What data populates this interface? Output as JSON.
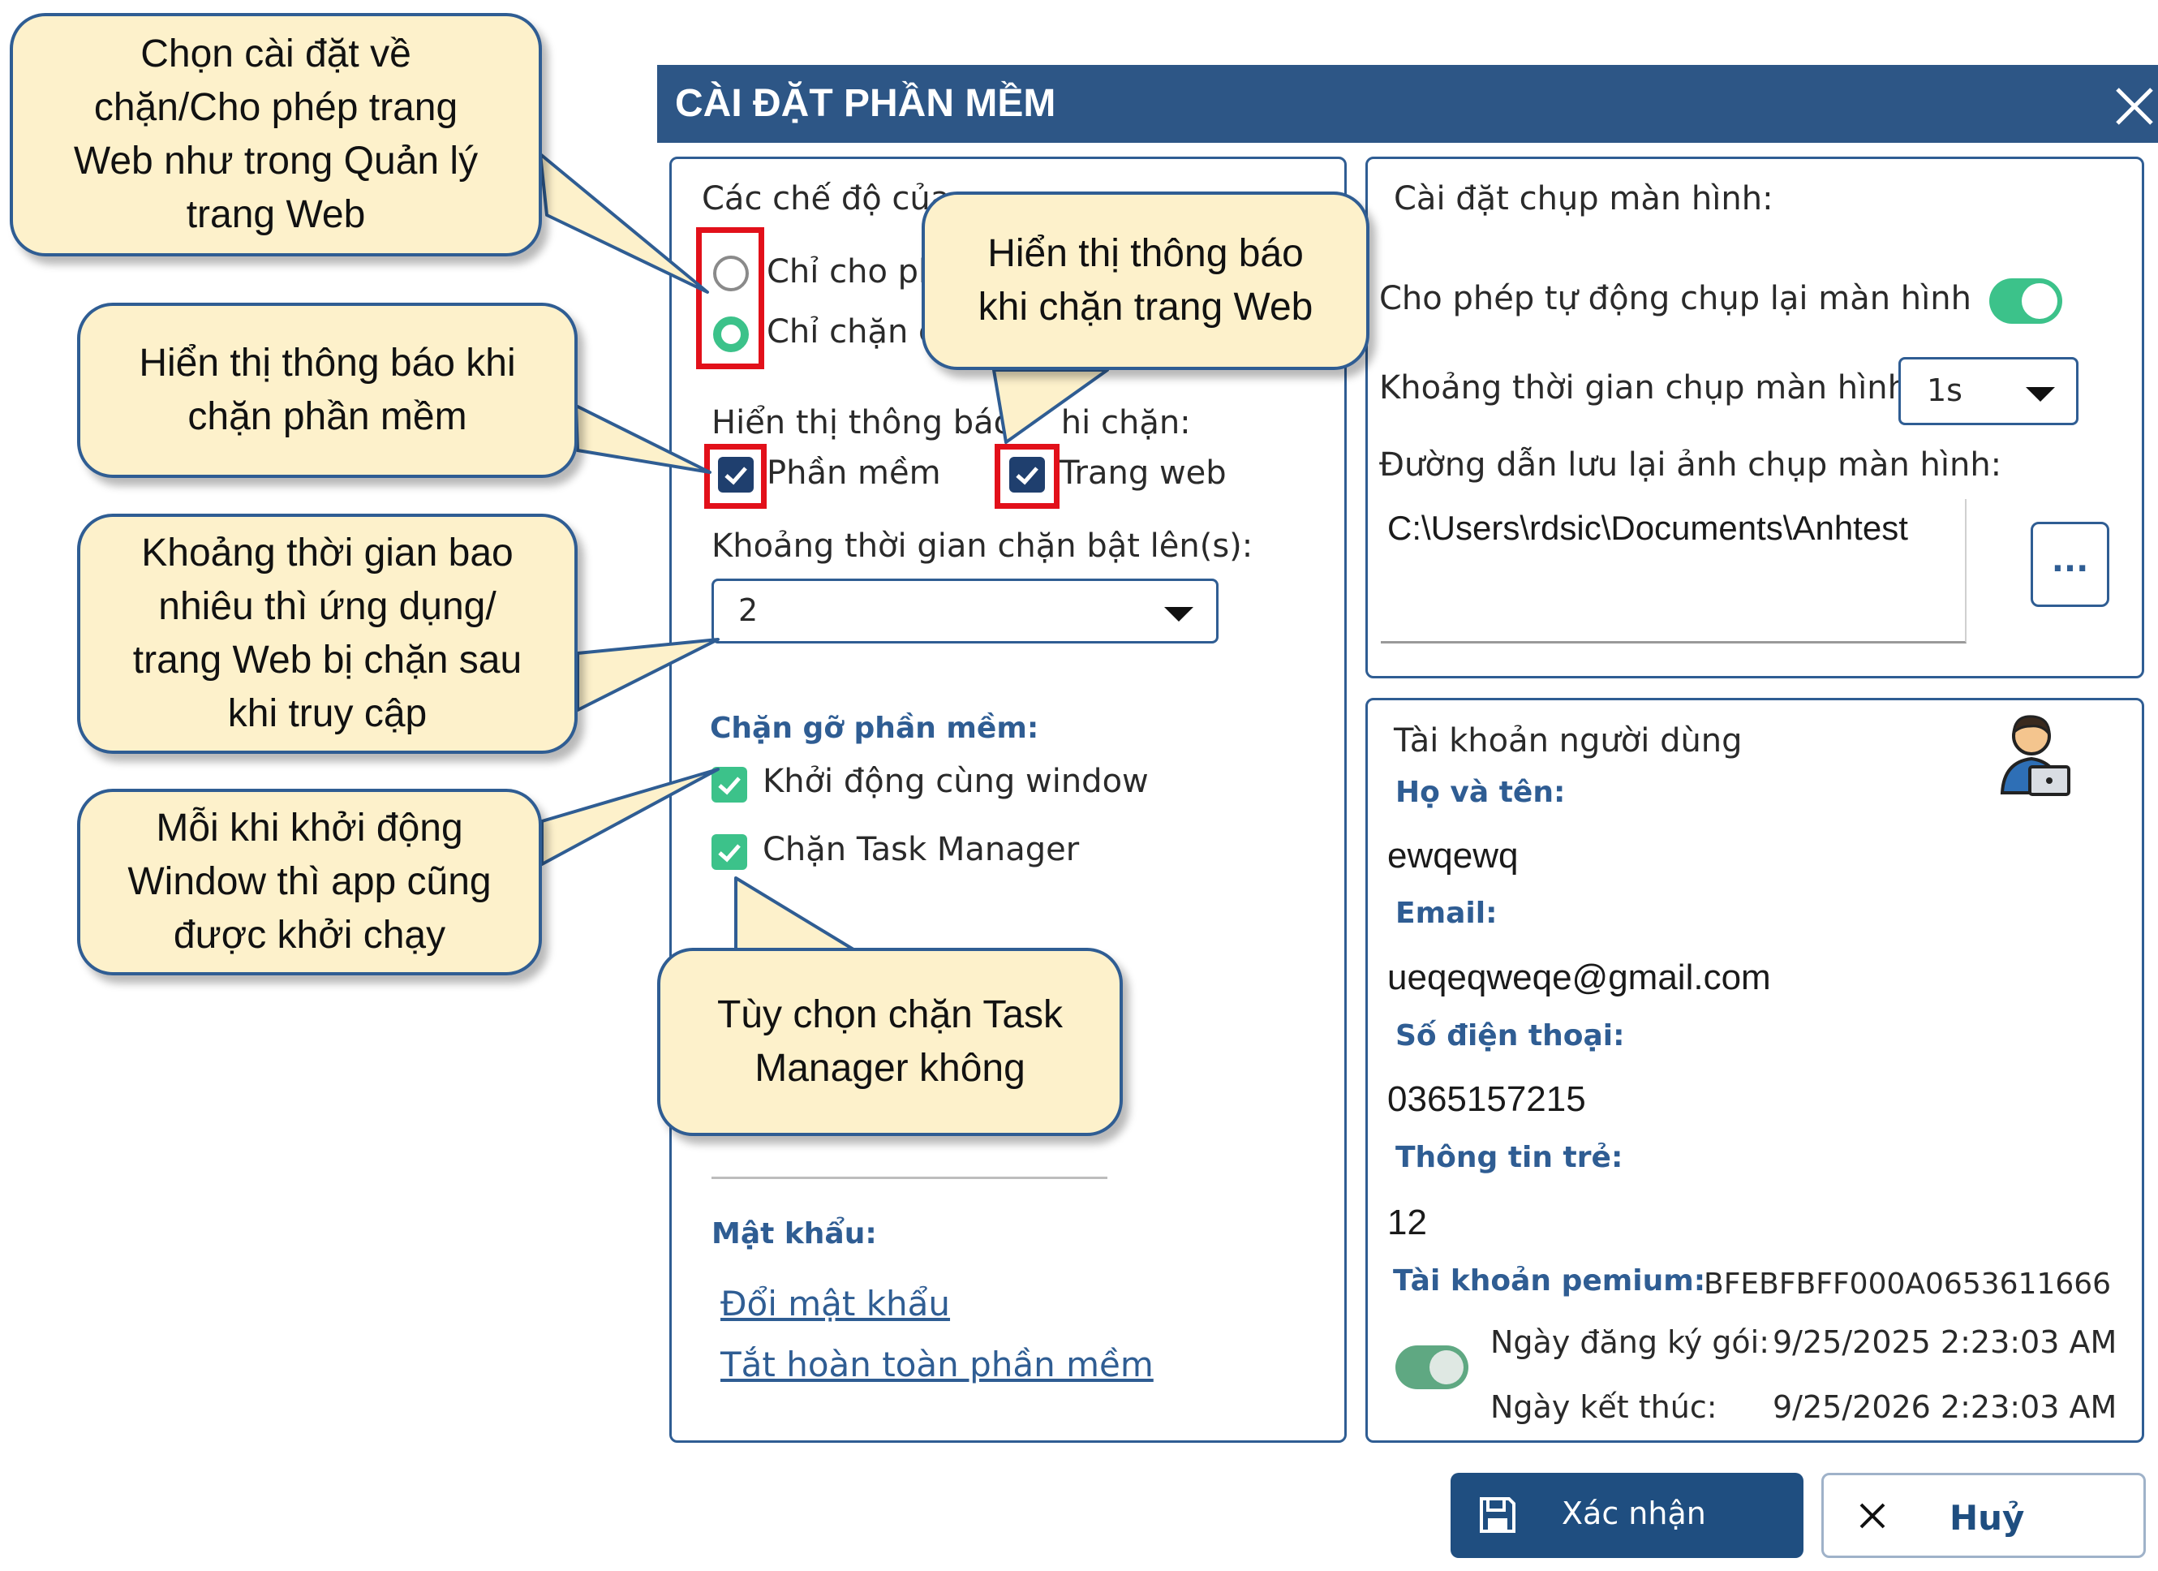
{
  "window": {
    "title": "CÀI ĐẶT PHẦN MỀM",
    "close_icon": "close-icon"
  },
  "left_panel": {
    "modes_label": "Các chế độ của ",
    "radio_allow_label": "Chỉ cho ph",
    "radio_block_label": "Chỉ chặn c",
    "radio_selected": "block",
    "notify_label": "Hiển thị thông báo ",
    "notify_label_tail": "hi chặn:",
    "chk_software_label": "Phần mềm",
    "chk_web_label": "Trang web",
    "interval_label": "Khoảng thời gian chặn bật lên(s):",
    "interval_value": "2",
    "uninstall_header": "Chặn gỡ phần mềm:",
    "chk_startup_label": "Khởi động cùng window",
    "chk_taskmgr_label": "Chặn Task Manager",
    "password_header": "Mật khẩu:",
    "link_change_password": "Đổi mật khẩu",
    "link_disable_app": "Tắt hoàn toàn phần mềm"
  },
  "screenshot_panel": {
    "header": "Cài đặt chụp màn hình:",
    "auto_capture_label": "Cho phép tự động chụp lại màn hình",
    "auto_capture_on": true,
    "interval_label": "Khoảng thời gian chụp màn hình:",
    "interval_value": "1s",
    "path_label": "Đường dẫn lưu lại ảnh chụp màn hình:",
    "path_value": "C:\\Users\\rdsic\\Documents\\Anhtest",
    "browse_label": "..."
  },
  "account_panel": {
    "header": "Tài khoản người dùng",
    "avatar_icon": "user-laptop-icon",
    "name_label": "Họ và tên:",
    "name_value": "ewqewq",
    "email_label": "Email:",
    "email_value": "ueqeqweqe@gmail.com",
    "phone_label": "Số điện thoại:",
    "phone_value": "0365157215",
    "child_label": "Thông tin trẻ:",
    "child_value": "12",
    "premium_label": "Tài khoản pemium:",
    "premium_value": "BFEBFBFF000A0653611666",
    "premium_on": true,
    "register_label": "Ngày đăng ký gói:",
    "register_value": "9/25/2025 2:23:03 AM",
    "end_label": "Ngày kết thúc:",
    "end_value": "9/25/2026 2:23:03 AM"
  },
  "footer": {
    "confirm_label": "Xác nhận",
    "confirm_icon": "save-icon",
    "cancel_label": "Huỷ",
    "cancel_icon": "close-icon"
  },
  "callouts": {
    "c1": "Chọn cài đặt về\nchặn/Cho phép trang\nWeb như trong Quản lý\ntrang Web",
    "c2": "Hiển thị thông báo khi\nchặn phần mềm",
    "c3": "Khoảng thời gian bao\nnhiêu thì ứng dụng/\ntrang Web bị chặn sau\nkhi truy cập",
    "c4": "Mỗi khi khởi động\nWindow thì app cũng\nđược khởi chạy",
    "c5": "Hiển thị thông báo\nkhi chặn trang Web",
    "c6": "Tùy chọn chặn Task\nManager không"
  },
  "colors": {
    "accent": "#2d5686",
    "toggle_on": "#3cc28a",
    "highlight": "#e2101a",
    "callout_fill": "#fdf1cb"
  }
}
